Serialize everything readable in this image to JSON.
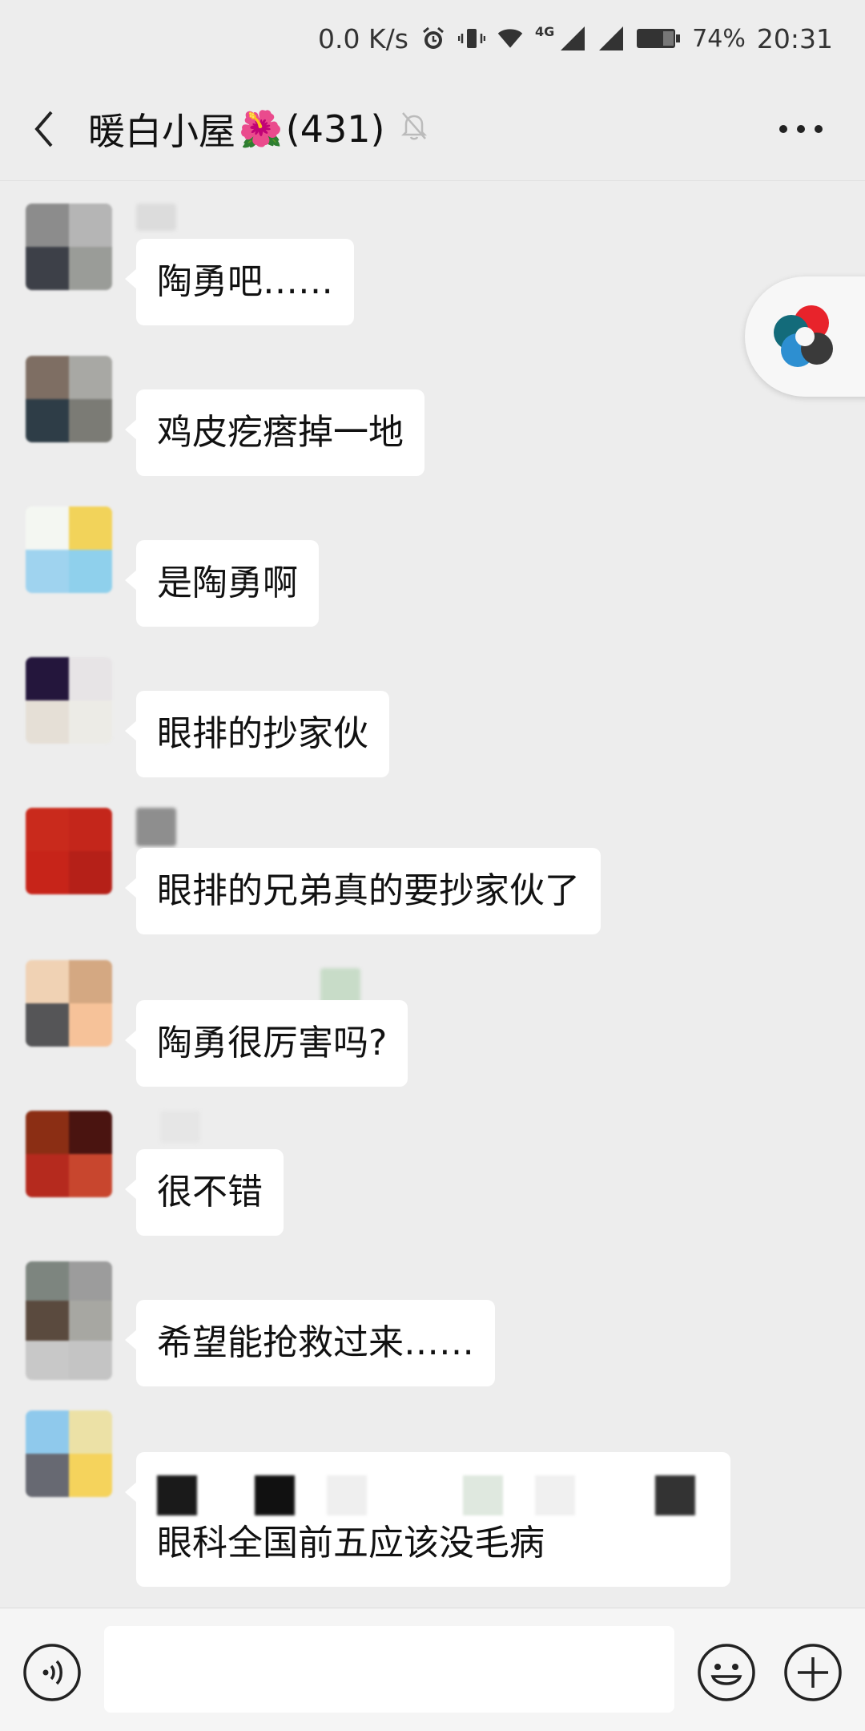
{
  "status_bar": {
    "speed": "0.0 K/s",
    "network": "4G",
    "battery": "74%",
    "time": "20:31",
    "icons": [
      "alarm-icon",
      "vibrate-icon",
      "wifi-icon",
      "signal-icon",
      "signal-icon",
      "battery-icon"
    ]
  },
  "header": {
    "title": "暖白小屋",
    "title_emoji": "🌺",
    "member_count": "(431)",
    "back_icon": "chevron-left-icon",
    "mute_icon": "bell-off-icon",
    "more_icon": "more-dots-icon"
  },
  "messages": [
    {
      "text": "陶勇吧……",
      "avatar_colors": [
        "#8c8c8c",
        "#b5b5b5",
        "#3d4048",
        "#9a9c98"
      ],
      "name_color": "#dcdcdc"
    },
    {
      "text": "鸡皮疙瘩掉一地",
      "avatar_colors": [
        "#7e6e63",
        "#a8a8a4",
        "#2e3d47",
        "#7b7b75"
      ],
      "name_color": ""
    },
    {
      "text": "是陶勇啊",
      "avatar_colors": [
        "#f4f7f2",
        "#f2d35a",
        "#9fd3ef",
        "#8fd0ec"
      ],
      "name_color": ""
    },
    {
      "text": "眼排的抄家伙",
      "avatar_colors": [
        "#24163c",
        "#e7e4e6",
        "#e5dfd6",
        "#ecebe6"
      ],
      "name_color": ""
    },
    {
      "text": "眼排的兄弟真的要抄家伙了",
      "avatar_colors": [
        "#c92a1c",
        "#c4261b",
        "#c72419",
        "#b52018"
      ],
      "name_color": "#8e8e8e"
    },
    {
      "text": "陶勇很厉害吗?",
      "avatar_colors": [
        "#f0d2b4",
        "#d4a882",
        "#555557",
        "#f6c299"
      ],
      "name_color": "#c8dcc8"
    },
    {
      "text": "很不错",
      "avatar_colors": [
        "#8b2e14",
        "#4a1410",
        "#b52a1e",
        "#c8462e"
      ],
      "name_color": "#e6e6e6"
    },
    {
      "text": "希望能抢救过来……",
      "avatar_colors": [
        "#7d857f",
        "#9c9c9c",
        "#5a4a3e",
        "#a7a7a2"
      ],
      "name_color": ""
    },
    {
      "text": "眼科全国前五应该没毛病",
      "avatar_colors": [
        "#8fc9ec",
        "#ece1a6",
        "#676972",
        "#f5d35c"
      ],
      "name_color": "",
      "quoted": true
    }
  ],
  "input": {
    "placeholder": "",
    "voice_icon": "voice-icon",
    "emoji_icon": "emoji-icon",
    "plus_icon": "plus-icon"
  },
  "colors": {
    "background": "#ededed",
    "bubble": "#ffffff",
    "bar": "#f5f5f5"
  }
}
